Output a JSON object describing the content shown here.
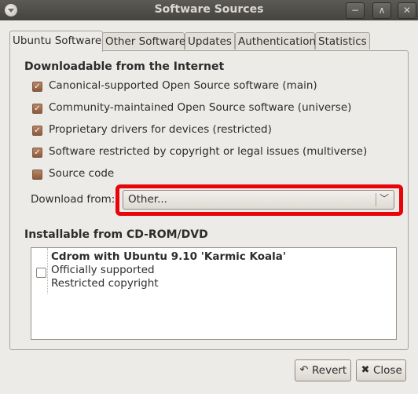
{
  "window": {
    "title": "Software Sources",
    "minimize_glyph": "−",
    "maximize_glyph": "∧",
    "close_glyph": "✕"
  },
  "tabs": [
    {
      "label": "Ubuntu Software",
      "active": true
    },
    {
      "label": "Other Software",
      "active": false
    },
    {
      "label": "Updates",
      "active": false
    },
    {
      "label": "Authentication",
      "active": false
    },
    {
      "label": "Statistics",
      "active": false
    }
  ],
  "internet": {
    "heading": "Downloadable from the Internet",
    "items": [
      {
        "label": "Canonical-supported Open Source software (main)",
        "checked": true
      },
      {
        "label": "Community-maintained Open Source software (universe)",
        "checked": true
      },
      {
        "label": "Proprietary drivers for devices (restricted)",
        "checked": true
      },
      {
        "label": "Software restricted by copyright or legal issues (multiverse)",
        "checked": true
      },
      {
        "label": "Source code",
        "checked": false
      }
    ],
    "download_from_label": "Download from:",
    "download_from_value": "Other..."
  },
  "cdrom": {
    "heading": "Installable from CD-ROM/DVD",
    "entry": {
      "checked": false,
      "title": "Cdrom with Ubuntu 9.10 'Karmic Koala'",
      "line1": "Officially supported",
      "line2": "Restricted copyright"
    }
  },
  "buttons": {
    "revert": {
      "label": "Revert",
      "icon": "revert-icon"
    },
    "close": {
      "label": "Close",
      "icon": "close-icon"
    }
  },
  "colors": {
    "highlight": "#e8050a",
    "checkbox": "#8c5a3c",
    "titlebar": "#45443f"
  }
}
